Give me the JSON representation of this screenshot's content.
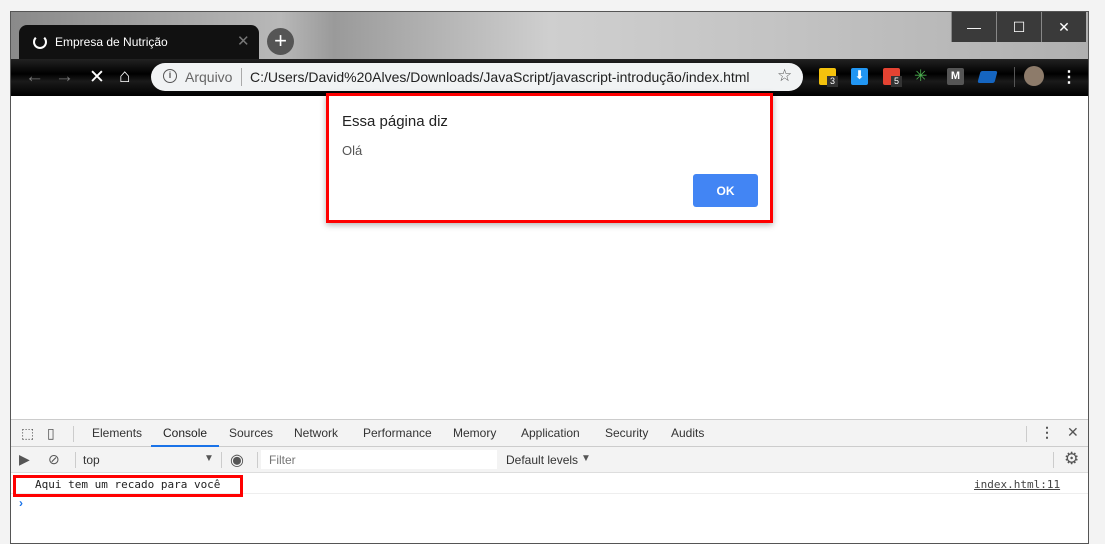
{
  "browser": {
    "tab_title": "Empresa de Nutrição",
    "address_scheme": "Arquivo",
    "address_url": "C:/Users/David%20Alves/Downloads/JavaScript/javascript-introdução/index.html",
    "extensions": [
      {
        "name": "ext-yellow",
        "badge": "3",
        "color": "#f4c20d"
      },
      {
        "name": "ext-download",
        "color": "#2196f3"
      },
      {
        "name": "ext-todoist",
        "badge": "5",
        "color": "#e44332"
      },
      {
        "name": "ext-star",
        "color": "#4caf50"
      },
      {
        "name": "ext-m",
        "color": "#555555"
      },
      {
        "name": "ext-blue",
        "color": "#1565c0"
      }
    ]
  },
  "dialog": {
    "title": "Essa página diz",
    "message": "Olá",
    "ok_label": "OK"
  },
  "devtools": {
    "tabs": [
      "Elements",
      "Console",
      "Sources",
      "Network",
      "Performance",
      "Memory",
      "Application",
      "Security",
      "Audits"
    ],
    "active_tab": "Console",
    "context": "top",
    "filter_placeholder": "Filter",
    "levels": "Default levels",
    "log": {
      "message": "Aqui tem um recado para você",
      "source": "index.html:11"
    }
  }
}
